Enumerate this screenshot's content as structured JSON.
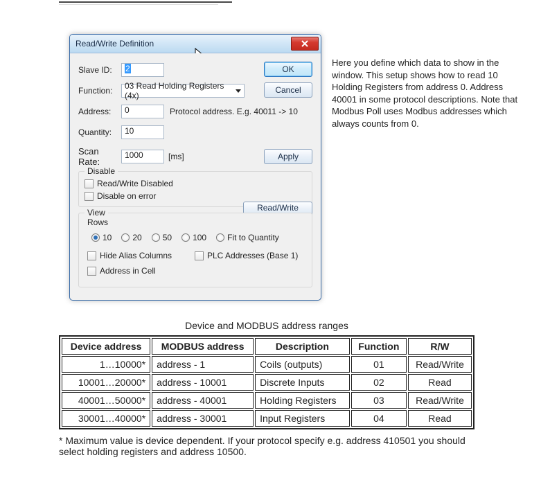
{
  "dialog": {
    "title": "Read/Write Definition",
    "buttons": {
      "ok": "OK",
      "cancel": "Cancel",
      "apply": "Apply",
      "rwonce": "Read/Write Once"
    },
    "labels": {
      "slave_id": "Slave ID:",
      "function": "Function:",
      "address": "Address:",
      "quantity": "Quantity:",
      "scan_rate": "Scan Rate:",
      "ms": "[ms]",
      "protocol_hint": "Protocol address. E.g. 40011 -> 10"
    },
    "values": {
      "slave_id": "2",
      "function": "03 Read Holding Registers (4x)",
      "address": "0",
      "quantity": "10",
      "scan_rate": "1000"
    },
    "disable_group": {
      "legend": "Disable",
      "rw_disabled": "Read/Write Disabled",
      "on_error": "Disable on error"
    },
    "view_group": {
      "legend": "View",
      "rows_label": "Rows",
      "opts": {
        "r10": "10",
        "r20": "20",
        "r50": "50",
        "r100": "100",
        "fit": "Fit to Quantity"
      },
      "selected": "10"
    },
    "bottom": {
      "hide_alias": "Hide Alias Columns",
      "plc": "PLC Addresses (Base 1)",
      "addr_in_cell": "Address in Cell"
    }
  },
  "side_desc": "Here you define which data to show in the window. This setup shows how to read 10 Holding Registers from address 0. Address 40001 in some protocol descriptions. Note that Modbus Poll uses Modbus addresses which always counts from 0.",
  "table": {
    "caption": "Device and MODBUS address ranges",
    "headers": {
      "dev": "Device address",
      "mod": "MODBUS address",
      "desc": "Description",
      "func": "Function",
      "rw": "R/W"
    },
    "rows": [
      {
        "dev": "1…10000*",
        "mod": "address - 1",
        "desc": "Coils (outputs)",
        "func": "01",
        "rw": "Read/Write"
      },
      {
        "dev": "10001…20000*",
        "mod": "address - 10001",
        "desc": "Discrete Inputs",
        "func": "02",
        "rw": "Read"
      },
      {
        "dev": "40001…50000*",
        "mod": "address - 40001",
        "desc": "Holding Registers",
        "func": "03",
        "rw": "Read/Write"
      },
      {
        "dev": "30001…40000*",
        "mod": "address - 30001",
        "desc": "Input Registers",
        "func": "04",
        "rw": "Read"
      }
    ]
  },
  "footnote": "* Maximum value is device dependent. If your protocol specify e.g. address 410501 you should select holding registers and address 10500."
}
